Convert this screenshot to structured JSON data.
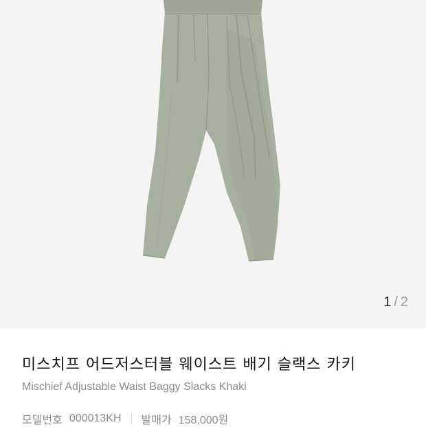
{
  "gallery": {
    "current_page": "1",
    "separator": "/",
    "total_pages": "2",
    "product_image": "khaki-wide-slacks-photo"
  },
  "product": {
    "name_ko": "미스치프 어드저스터블 웨이스트 배기 슬랙스 카키",
    "name_en": "Mischief Adjustable Waist Baggy Slacks Khaki",
    "model_label": "모델번호",
    "model_value": "000013KH",
    "price_label": "발매가",
    "price_value": "158,000원"
  },
  "colors": {
    "pants": "#a7b09f",
    "pants_shadow": "#8f9887",
    "background": "#f4f4f4"
  }
}
